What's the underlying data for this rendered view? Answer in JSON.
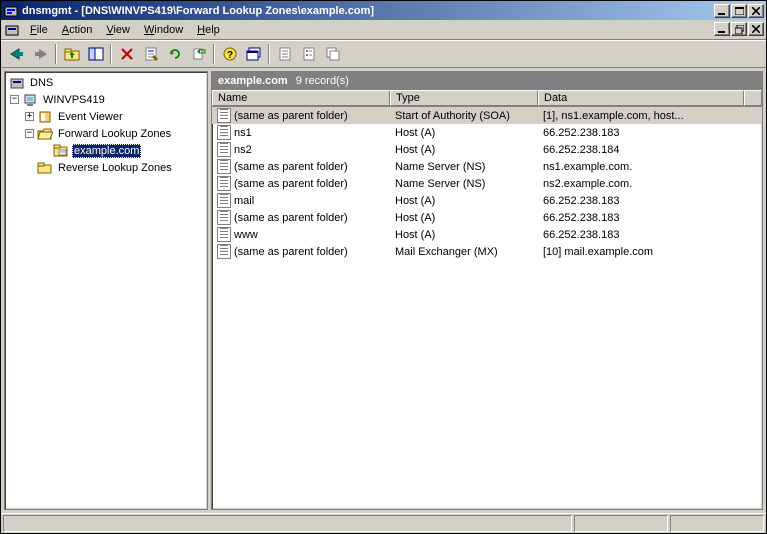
{
  "window": {
    "title": "dnsmgmt - [DNS\\WINVPS419\\Forward Lookup Zones\\example.com]"
  },
  "menu": {
    "file": "File",
    "action": "Action",
    "view": "View",
    "window": "Window",
    "help": "Help"
  },
  "tree": {
    "root": "DNS",
    "server": "WINVPS419",
    "event_viewer": "Event Viewer",
    "forward": "Forward Lookup Zones",
    "zone": "example.com",
    "reverse": "Reverse Lookup Zones"
  },
  "list": {
    "zone_name": "example.com",
    "record_count": "9 record(s)",
    "columns": {
      "name": "Name",
      "type": "Type",
      "data": "Data"
    },
    "rows": [
      {
        "name": "(same as parent folder)",
        "type": "Start of Authority (SOA)",
        "data": "[1], ns1.example.com, host...",
        "selected": true
      },
      {
        "name": "ns1",
        "type": "Host (A)",
        "data": "66.252.238.183"
      },
      {
        "name": "ns2",
        "type": "Host (A)",
        "data": "66.252.238.184"
      },
      {
        "name": "(same as parent folder)",
        "type": "Name Server (NS)",
        "data": "ns1.example.com."
      },
      {
        "name": "(same as parent folder)",
        "type": "Name Server (NS)",
        "data": "ns2.example.com."
      },
      {
        "name": "mail",
        "type": "Host (A)",
        "data": "66.252.238.183"
      },
      {
        "name": "(same as parent folder)",
        "type": "Host (A)",
        "data": "66.252.238.183"
      },
      {
        "name": "www",
        "type": "Host (A)",
        "data": "66.252.238.183"
      },
      {
        "name": "(same as parent folder)",
        "type": "Mail Exchanger (MX)",
        "data": "[10]  mail.example.com"
      }
    ]
  }
}
